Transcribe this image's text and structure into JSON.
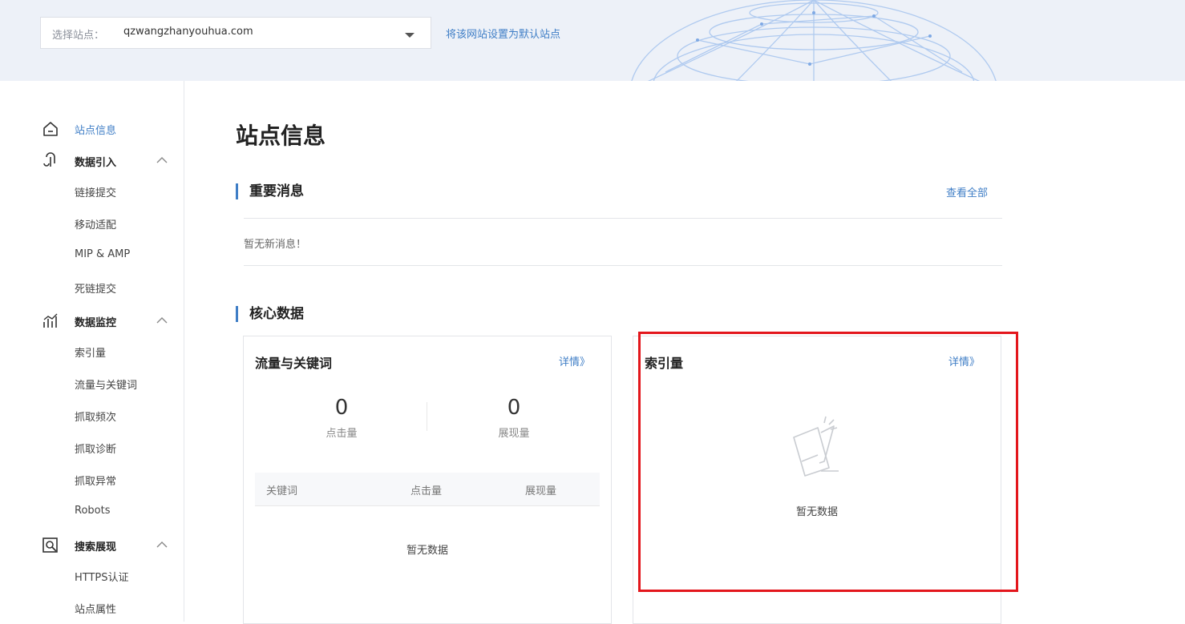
{
  "header": {
    "site_label": "选择站点：",
    "site_value": "qzwangzhanyouhua.com",
    "set_default": "将该网站设置为默认站点"
  },
  "sidebar": {
    "groups": [
      {
        "label": "站点信息",
        "icon": "home-icon",
        "active": true
      },
      {
        "label": "数据引入",
        "icon": "data-import-icon",
        "expanded": true,
        "items": [
          "链接提交",
          "移动适配",
          "MIP & AMP",
          "死链提交"
        ]
      },
      {
        "label": "数据监控",
        "icon": "chart-icon",
        "expanded": true,
        "items": [
          "索引量",
          "流量与关键词",
          "抓取频次",
          "抓取诊断",
          "抓取异常",
          "Robots"
        ]
      },
      {
        "label": "搜索展现",
        "icon": "search-display-icon",
        "expanded": true,
        "items": [
          "HTTPS认证",
          "站点属性"
        ]
      }
    ]
  },
  "main": {
    "title": "站点信息",
    "messages": {
      "heading": "重要消息",
      "view_all": "查看全部",
      "empty": "暂无新消息！"
    },
    "core": {
      "heading": "核心数据",
      "traffic_card": {
        "title": "流量与关键词",
        "more": "详情》",
        "clicks_value": "0",
        "clicks_label": "点击量",
        "impressions_value": "0",
        "impressions_label": "展现量",
        "columns": [
          "关键词",
          "点击量",
          "展现量"
        ],
        "empty": "暂无数据"
      },
      "index_card": {
        "title": "索引量",
        "more": "详情》",
        "empty": "暂无数据"
      }
    }
  },
  "colors": {
    "accent": "#3f7ec6",
    "header_bg": "#edf1f8",
    "highlight": "#e3161c"
  }
}
